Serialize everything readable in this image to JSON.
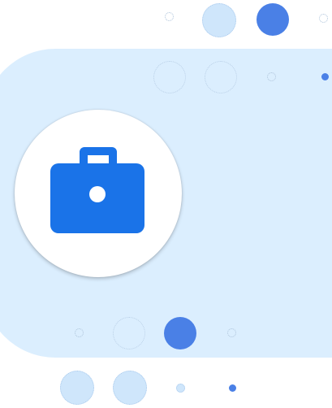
{
  "illustration": {
    "icon": "briefcase-icon",
    "colors": {
      "panel": "#dbeefe",
      "accent": "#4a80e6",
      "icon": "#1a73e8",
      "badge": "#ffffff"
    }
  }
}
